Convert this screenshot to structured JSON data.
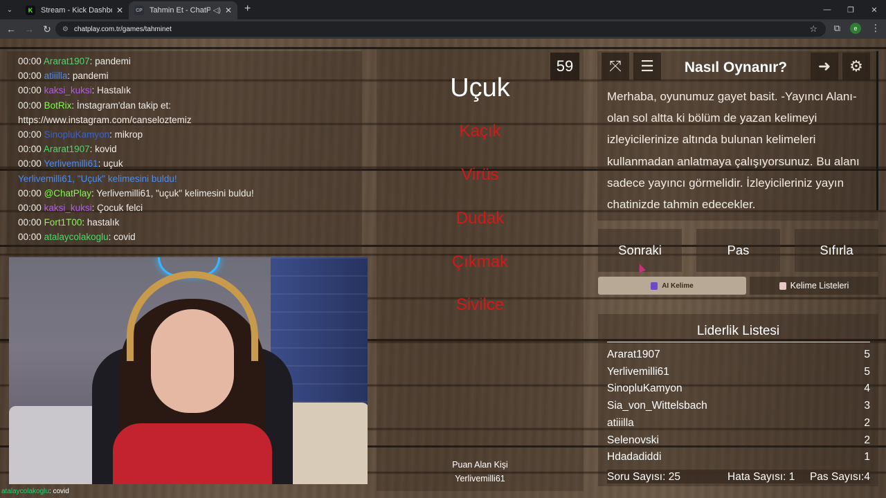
{
  "browser": {
    "tabs": [
      {
        "title": "Stream - Kick Dashboard",
        "favicon": "K",
        "active": false
      },
      {
        "title": "Tahmin Et - ChatPlay",
        "favicon": "CP",
        "active": true
      }
    ],
    "url": "chatplay.com.tr/games/tahminet",
    "profile_initial": "e"
  },
  "chat": {
    "messages": [
      {
        "time": "00:00",
        "user": "Ararat1907",
        "color": "#4fd66a",
        "text": ": pandemi"
      },
      {
        "time": "00:00",
        "user": "atiiilla",
        "color": "#4b8cf0",
        "text": ": pandemi"
      },
      {
        "time": "00:00",
        "user": "kaksi_kuksi",
        "color": "#b05ce8",
        "text": ": Hastalık"
      },
      {
        "time": "00:00",
        "user": "BotRix",
        "color": "#7cfc4a",
        "text": ": İnstagram'dan takip et:"
      },
      {
        "time": "",
        "user": "",
        "color": "#ffffff",
        "text": "https://www.instagram.com/canseloztemiz"
      },
      {
        "time": "00:00",
        "user": "SinopluKamyon",
        "color": "#3a63c9",
        "text": ": mikrop"
      },
      {
        "time": "00:00",
        "user": "Ararat1907",
        "color": "#4fd66a",
        "text": ": kovid"
      },
      {
        "time": "00:00",
        "user": "Yerlivemilli61",
        "color": "#4b8cf0",
        "text": ": uçuk"
      },
      {
        "time": "",
        "user": "",
        "color": "#4b8cf0",
        "text": "Yerlivemilli61, \"Uçuk\" kelimesini buldu!",
        "system": true
      },
      {
        "time": "00:00",
        "user": "@ChatPlay",
        "color": "#7cfc4a",
        "text": ": Yerlivemilli61, \"uçuk\" kelimesini buldu!"
      },
      {
        "time": "00:00",
        "user": "kaksi_kuksi",
        "color": "#b05ce8",
        "text": ": Çocuk felci"
      },
      {
        "time": "00:00",
        "user": "Fort1T00",
        "color": "#7cfc4a",
        "text": ": hastalık"
      },
      {
        "time": "00:00",
        "user": "atalaycolakoglu",
        "color": "#4fd66a",
        "text": ": covid"
      }
    ],
    "cam_caption_user": "atalaycolakoglu",
    "cam_caption_text": ": covid"
  },
  "game": {
    "word": "Uçuk",
    "timer": "59",
    "taboo_words": [
      "Kaçık",
      "Virüs",
      "Dudak",
      "Çıkmak",
      "Sivilce"
    ],
    "scorer_label": "Puan Alan Kişi",
    "scorer_name": "Yerlivemilli61"
  },
  "howto": {
    "title": "Nasıl Oynanır?",
    "text": "Merhaba, oyunumuz gayet basit. -Yayıncı Alanı- olan sol altta ki bölüm de yazan kelimeyi izleyicilerinize altında bulunan kelimeleri kullanmadan anlatmaya çalışıyorsunuz. Bu alanı sadece yayıncı görmelidir. İzleyicileriniz yayın chatinizde tahmin edecekler."
  },
  "controls": {
    "next": "Sonraki",
    "pass": "Pas",
    "reset": "Sıfırla",
    "ai_word": "AI Kelime",
    "word_lists": "Kelime Listeleri"
  },
  "leaderboard": {
    "title": "Liderlik Listesi",
    "rows": [
      {
        "name": "Ararat1907",
        "score": "5"
      },
      {
        "name": "Yerlivemilli61",
        "score": "5"
      },
      {
        "name": "SinopluKamyon",
        "score": "4"
      },
      {
        "name": "Sia_von_Wittelsbach",
        "score": "3"
      },
      {
        "name": "atiiilla",
        "score": "2"
      },
      {
        "name": "Selenovski",
        "score": "2"
      },
      {
        "name": "Hdadadiddi",
        "score": "1"
      }
    ],
    "stats": {
      "questions_label": "Soru Sayısı:",
      "questions": "25",
      "errors_label": "Hata Sayısı:",
      "errors": "1",
      "passes_label": "Pas Sayısı:",
      "passes": "4"
    }
  }
}
